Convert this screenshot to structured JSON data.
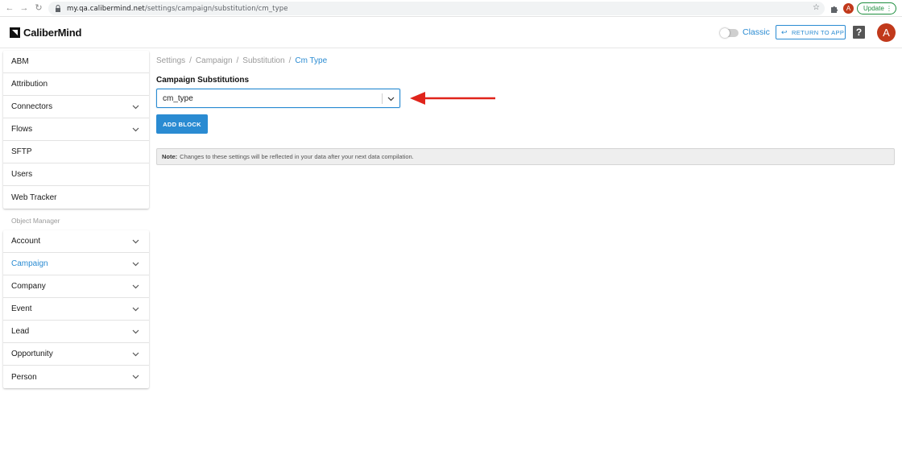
{
  "browser": {
    "url_host": "my.qa.calibermind.net",
    "url_path": "/settings/campaign/substitution/cm_type",
    "profile_initial": "A",
    "update_label": "Update"
  },
  "header": {
    "logo_text": "CaliberMind",
    "classic_label": "Classic",
    "return_label": "RETURN TO APP",
    "help_label": "?",
    "avatar_initial": "A",
    "accent_color": "#2a8bd2",
    "avatar_color": "#c1391b"
  },
  "sidebar": {
    "top_items": [
      {
        "label": "ABM",
        "chevron": false
      },
      {
        "label": "Attribution",
        "chevron": false
      },
      {
        "label": "Connectors",
        "chevron": true
      },
      {
        "label": "Flows",
        "chevron": true
      },
      {
        "label": "SFTP",
        "chevron": false
      },
      {
        "label": "Users",
        "chevron": false
      },
      {
        "label": "Web Tracker",
        "chevron": false
      }
    ],
    "object_manager_title": "Object Manager",
    "object_items": [
      {
        "label": "Account",
        "active": false
      },
      {
        "label": "Campaign",
        "active": true
      },
      {
        "label": "Company",
        "active": false
      },
      {
        "label": "Event",
        "active": false
      },
      {
        "label": "Lead",
        "active": false
      },
      {
        "label": "Opportunity",
        "active": false
      },
      {
        "label": "Person",
        "active": false
      }
    ]
  },
  "main": {
    "breadcrumb": [
      "Settings",
      "Campaign",
      "Substitution",
      "Cm Type"
    ],
    "section_title": "Campaign Substitutions",
    "select_value": "cm_type",
    "add_block_label": "ADD BLOCK",
    "note_label": "Note:",
    "note_text": "Changes to these settings will be reflected in your data after your next data compilation."
  }
}
